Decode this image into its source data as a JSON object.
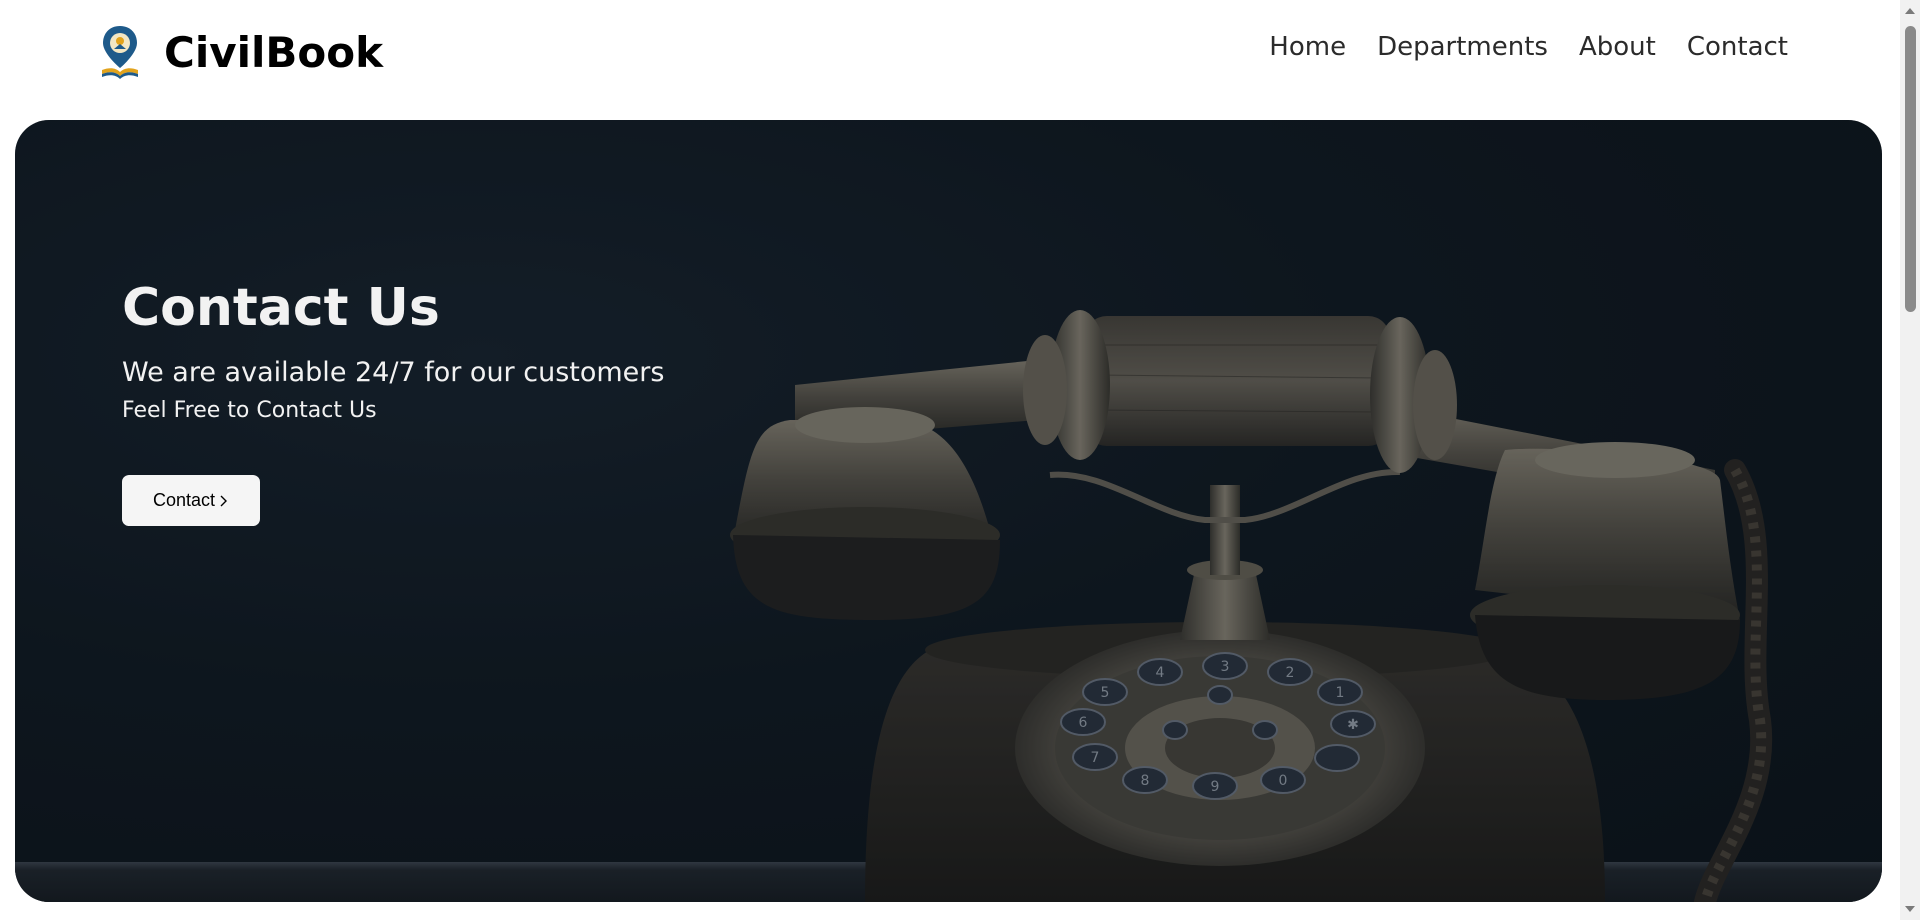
{
  "brand": {
    "name": "CivilBook",
    "logo_icon": "map-pin-book-icon",
    "colors": {
      "pin": "#1e5a8a",
      "accent": "#e2a31c"
    }
  },
  "nav": {
    "items": [
      {
        "label": "Home"
      },
      {
        "label": "Departments"
      },
      {
        "label": "About"
      },
      {
        "label": "Contact"
      }
    ]
  },
  "hero": {
    "title": "Contact Us",
    "subtitle": "We are available 24/7 for our customers",
    "tagline": "Feel Free to Contact Us",
    "button": {
      "label": "Contact",
      "icon": "chevron-right-icon"
    },
    "background_image": "vintage-rotary-telephone-image",
    "dial_digits": [
      "1",
      "2",
      "3",
      "4",
      "5",
      "6",
      "7",
      "8",
      "9",
      "0",
      "✱"
    ]
  },
  "colors": {
    "hero_background": "#0f1820",
    "hero_text": "#f2f2f2",
    "button_background": "#f5f5f5",
    "nav_text": "#2b2b2b"
  }
}
